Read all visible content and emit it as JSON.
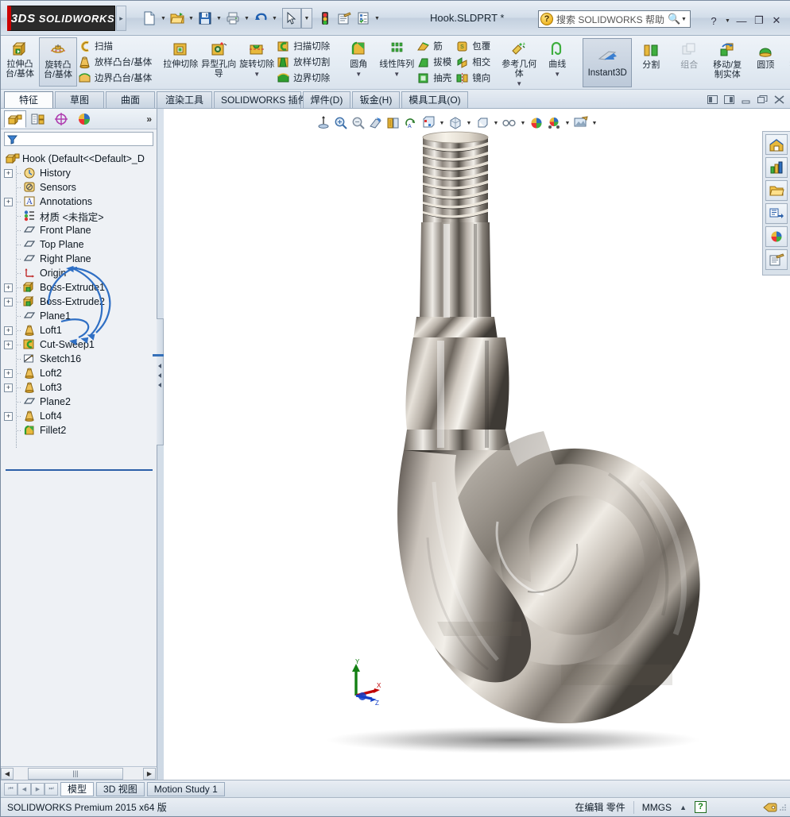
{
  "window": {
    "brand": "SOLIDWORKS",
    "brand_prefix": "3DS",
    "document_title": "Hook.SLDPRT *",
    "logo_expand_icon": "chevron-right-icon"
  },
  "quick_access": {
    "items": [
      {
        "name": "new-document-icon",
        "label": "新建"
      },
      {
        "name": "open-document-icon",
        "label": "打开"
      },
      {
        "name": "save-icon",
        "label": "保存"
      },
      {
        "name": "print-icon",
        "label": "打印"
      },
      {
        "name": "undo-icon",
        "label": "撤销"
      },
      {
        "name": "select-cursor-icon",
        "label": "选择"
      },
      {
        "name": "rebuild-icon",
        "label": "重建模型"
      },
      {
        "name": "file-properties-icon",
        "label": "文件属性"
      },
      {
        "name": "options-icon",
        "label": "选项"
      }
    ]
  },
  "search": {
    "placeholder": "搜索 SOLIDWORKS 帮助",
    "icon": "help-search-icon",
    "magnifier_icon": "magnifier-icon"
  },
  "window_buttons": {
    "help": "?",
    "minimize": "—",
    "restore": "❐",
    "close": "✕"
  },
  "doc_window_buttons": {
    "restore_left": "⊏⊐",
    "restore_right": "⊏⊐",
    "minimize": "—",
    "maximize": "❐",
    "close": "✕"
  },
  "ribbon": {
    "groups": [
      {
        "name": "features-boss",
        "big": [
          {
            "label": "拉伸凸台/基体",
            "icon": "extrude-boss-icon",
            "selected": false,
            "dropdown": false
          },
          {
            "label": "旋转凸台/基体",
            "icon": "revolve-boss-icon",
            "selected": true,
            "dropdown": false
          }
        ],
        "small": [
          {
            "label": "扫描",
            "icon": "sweep-icon"
          },
          {
            "label": "放样凸台/基体",
            "icon": "loft-boss-icon"
          },
          {
            "label": "边界凸台/基体",
            "icon": "boundary-boss-icon"
          }
        ]
      },
      {
        "name": "features-cut",
        "big": [
          {
            "label": "拉伸切除",
            "icon": "extrude-cut-icon",
            "selected": false,
            "dropdown": false
          },
          {
            "label": "异型孔向导",
            "icon": "hole-wizard-icon",
            "selected": false,
            "dropdown": false
          },
          {
            "label": "旋转切除",
            "icon": "revolve-cut-icon",
            "selected": false,
            "dropdown": true
          }
        ],
        "small": [
          {
            "label": "扫描切除",
            "icon": "sweep-cut-icon"
          },
          {
            "label": "放样切割",
            "icon": "loft-cut-icon"
          },
          {
            "label": "边界切除",
            "icon": "boundary-cut-icon"
          }
        ]
      },
      {
        "name": "features-modify",
        "big": [
          {
            "label": "圆角",
            "icon": "fillet-icon",
            "selected": false,
            "dropdown": true
          },
          {
            "label": "线性阵列",
            "icon": "linear-pattern-icon",
            "selected": false,
            "dropdown": true
          }
        ],
        "small": [
          {
            "label": "筋",
            "icon": "rib-icon"
          },
          {
            "label": "拔模",
            "icon": "draft-icon"
          },
          {
            "label": "抽壳",
            "icon": "shell-icon"
          }
        ],
        "small2": [
          {
            "label": "包覆",
            "icon": "wrap-icon"
          },
          {
            "label": "相交",
            "icon": "intersect-icon"
          },
          {
            "label": "镜向",
            "icon": "mirror-icon"
          }
        ]
      },
      {
        "name": "features-reference",
        "big": [
          {
            "label": "参考几何体",
            "icon": "reference-geometry-icon",
            "selected": false,
            "dropdown": true
          },
          {
            "label": "曲线",
            "icon": "curves-icon",
            "selected": false,
            "dropdown": true
          }
        ],
        "small": []
      },
      {
        "name": "features-direct",
        "instant3d": {
          "label": "Instant3D",
          "icon": "instant3d-icon",
          "selected": true
        },
        "big": [
          {
            "label": "分割",
            "icon": "split-icon",
            "selected": false,
            "dropdown": false
          },
          {
            "label": "组合",
            "icon": "combine-icon",
            "selected": false,
            "dropdown": false,
            "disabled": true
          },
          {
            "label": "移动/复制实体",
            "icon": "move-copy-body-icon",
            "selected": false,
            "dropdown": false
          },
          {
            "label": "圆顶",
            "icon": "dome-icon",
            "selected": false,
            "dropdown": false
          }
        ],
        "overflow": "»"
      }
    ]
  },
  "command_tabs": {
    "items": [
      {
        "label": "特征",
        "active": true
      },
      {
        "label": "草图",
        "active": false
      },
      {
        "label": "曲面",
        "active": false
      },
      {
        "label": "渲染工具",
        "active": false
      },
      {
        "label": "SOLIDWORKS 插件",
        "active": false
      },
      {
        "label": "焊件(D)",
        "active": false
      },
      {
        "label": "钣金(H)",
        "active": false
      },
      {
        "label": "模具工具(O)",
        "active": false
      }
    ]
  },
  "tree_panel": {
    "tabs": [
      {
        "name": "feature-manager-tab",
        "icon": "feature-tree-icon",
        "active": true
      },
      {
        "name": "property-manager-tab",
        "icon": "property-manager-icon",
        "active": false
      },
      {
        "name": "configuration-manager-tab",
        "icon": "configuration-icon",
        "active": false
      },
      {
        "name": "display-manager-tab",
        "icon": "display-manager-icon",
        "active": false
      }
    ],
    "more": "»",
    "filter_icon": "filter-icon",
    "root": {
      "label": "Hook  (Default<<Default>_D",
      "icon": "part-icon"
    },
    "items": [
      {
        "label": "History",
        "icon": "history-icon",
        "expandable": true
      },
      {
        "label": "Sensors",
        "icon": "sensors-icon",
        "expandable": false
      },
      {
        "label": "Annotations",
        "icon": "annotations-icon",
        "expandable": true
      },
      {
        "label": "材质 <未指定>",
        "icon": "material-icon",
        "expandable": false
      },
      {
        "label": "Front Plane",
        "icon": "plane-icon",
        "expandable": false
      },
      {
        "label": "Top Plane",
        "icon": "plane-icon",
        "expandable": false
      },
      {
        "label": "Right Plane",
        "icon": "plane-icon",
        "expandable": false
      },
      {
        "label": "Origin",
        "icon": "origin-icon",
        "expandable": false
      },
      {
        "label": "Boss-Extrude1",
        "icon": "boss-extrude-icon",
        "expandable": true
      },
      {
        "label": "Boss-Extrude2",
        "icon": "boss-extrude-icon",
        "expandable": true
      },
      {
        "label": "Plane1",
        "icon": "plane-icon",
        "expandable": false
      },
      {
        "label": "Loft1",
        "icon": "loft-icon",
        "expandable": true
      },
      {
        "label": "Cut-Sweep1",
        "icon": "cut-sweep-icon",
        "expandable": true
      },
      {
        "label": "Sketch16",
        "icon": "sketch-icon",
        "expandable": false
      },
      {
        "label": "Loft2",
        "icon": "loft-icon",
        "expandable": true
      },
      {
        "label": "Loft3",
        "icon": "loft-icon",
        "expandable": true
      },
      {
        "label": "Plane2",
        "icon": "plane-icon",
        "expandable": false
      },
      {
        "label": "Loft4",
        "icon": "loft-icon",
        "expandable": true
      },
      {
        "label": "Fillet2",
        "icon": "fillet-feature-icon",
        "expandable": false
      }
    ],
    "scroll": {
      "left_arrow": "◀",
      "right_arrow": "▶",
      "thumb_grip": "|||"
    }
  },
  "view_toolbar": {
    "items": [
      {
        "name": "zoom-to-fit-icon",
        "caret": false
      },
      {
        "name": "zoom-to-area-icon",
        "caret": false
      },
      {
        "name": "previous-view-icon",
        "caret": false
      },
      {
        "name": "section-view-icon",
        "caret": false
      },
      {
        "name": "view-orientation-icon",
        "caret": false
      },
      {
        "name": "rotate-view-icon",
        "caret": false
      },
      {
        "name": "display-style-icon",
        "caret": true
      },
      {
        "name": "hide-show-items-icon",
        "caret": true
      },
      {
        "name": "view-settings-icon",
        "caret": true
      },
      {
        "name": "edit-appearance-icon",
        "caret": true
      },
      {
        "name": "apply-scene-icon",
        "caret": false
      },
      {
        "name": "view-orientation-cube-icon",
        "caret": true
      },
      {
        "name": "render-preview-icon",
        "caret": true
      }
    ]
  },
  "task_pane": {
    "items": [
      {
        "name": "sw-resources-icon"
      },
      {
        "name": "design-library-icon"
      },
      {
        "name": "file-explorer-icon"
      },
      {
        "name": "view-palette-icon"
      },
      {
        "name": "appearances-scenes-icon"
      },
      {
        "name": "custom-properties-icon"
      }
    ]
  },
  "triad": {
    "x_label": "X",
    "y_label": "Y",
    "z_label": "Z",
    "x_color": "#c00000",
    "y_color": "#138013",
    "z_color": "#1540c8"
  },
  "model": {
    "name": "hook-3d-model",
    "material": "polished chrome steel",
    "shadow": true
  },
  "bottom_tabs": {
    "nav": [
      "⏮",
      "◀",
      "▶",
      "⏭"
    ],
    "items": [
      {
        "label": "模型",
        "active": true
      },
      {
        "label": "3D 视图",
        "active": false
      },
      {
        "label": "Motion Study 1",
        "active": false
      }
    ]
  },
  "status_bar": {
    "version": "SOLIDWORKS Premium 2015 x64 版",
    "edit_state": "在编辑 零件",
    "units": "MMGS",
    "units_caret": "▲",
    "help_badge": "?",
    "tag_icon": "tag-icon"
  },
  "colors": {
    "brand_red": "#cc0000",
    "ribbon_bg": "#e3ebf3",
    "accent_blue": "#2b5fa8",
    "selection": "#cdd8e5"
  }
}
